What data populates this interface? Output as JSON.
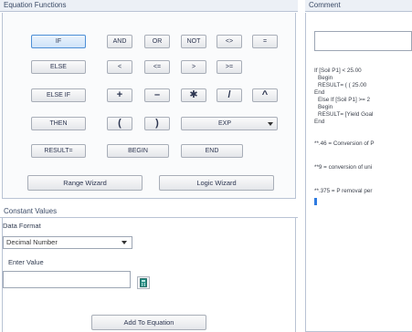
{
  "equation_functions": {
    "title": "Equation Functions",
    "buttons": {
      "if": "IF",
      "and": "AND",
      "or": "OR",
      "not": "NOT",
      "neq": "<>",
      "eq": "=",
      "else": "ELSE",
      "lt": "<",
      "lte": "<=",
      "gt": ">",
      "gte": ">=",
      "else_if": "ELSE IF",
      "plus": "+",
      "minus": "–",
      "multiply": "✱",
      "divide": "/",
      "power": "^",
      "then": "THEN",
      "open_paren": "(",
      "close_paren": ")",
      "exp": "EXP",
      "result": "RESULT=",
      "begin": "BEGIN",
      "end": "END"
    },
    "range_wizard": "Range Wizard",
    "logic_wizard": "Logic Wizard"
  },
  "constant_values": {
    "title": "Constant Values",
    "data_format_label": "Data Format",
    "data_format_value": "Decimal Number",
    "enter_value_label": "Enter Value",
    "enter_value": "",
    "add_button": "Add To Equation"
  },
  "comment": {
    "title": "Comment",
    "lines": [
      "If [Soil P1] < 25.00",
      "Begin",
      "RESULT= ( ( 25.00",
      "End",
      "Else If [Soil P1] >= 2",
      "Begin",
      "RESULT= [Yield Goal",
      "End",
      "",
      "**.46 = Conversion of P",
      "",
      "**9 = conversion of uni",
      "",
      "**.375 = P removal per"
    ]
  }
}
